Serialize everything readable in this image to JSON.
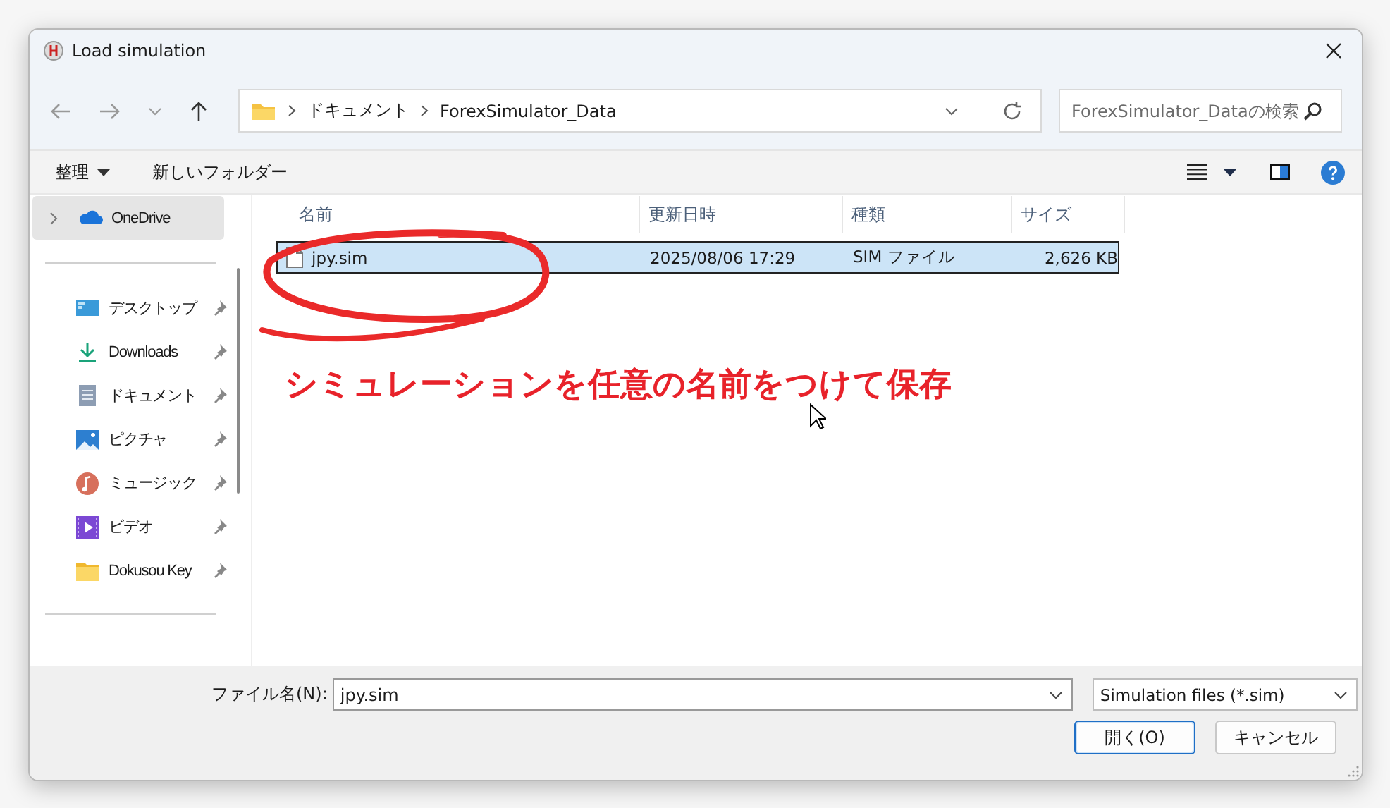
{
  "window": {
    "title": "Load simulation"
  },
  "nav": {
    "path": [
      "ドキュメント",
      "ForexSimulator_Data"
    ],
    "search": {
      "placeholder": "ForexSimulator_Dataの検索"
    }
  },
  "toolbar": {
    "items": [
      "整理",
      "新しいフォルダー"
    ]
  },
  "sidebar": {
    "items": [
      {
        "label": "OneDrive",
        "kind": "cloud",
        "selected": true,
        "pinned": false
      },
      {
        "label": "デスクトップ",
        "kind": "desktop",
        "selected": false,
        "pinned": true
      },
      {
        "label": "Downloads",
        "kind": "download",
        "selected": false,
        "pinned": true
      },
      {
        "label": "ドキュメント",
        "kind": "document",
        "selected": false,
        "pinned": true
      },
      {
        "label": "ピクチャ",
        "kind": "picture",
        "selected": false,
        "pinned": true
      },
      {
        "label": "ミュージック",
        "kind": "music",
        "selected": false,
        "pinned": true
      },
      {
        "label": "ビデオ",
        "kind": "video",
        "selected": false,
        "pinned": true
      },
      {
        "label": "Dokusou Key",
        "kind": "folder",
        "selected": false,
        "pinned": true
      }
    ]
  },
  "table": {
    "columns": [
      "名前",
      "更新日時",
      "種類",
      "サイズ"
    ],
    "rows": [
      {
        "cells": [
          "jpy.sim",
          "2025/08/06 17:29",
          "SIM ファイル",
          "2,626 KB"
        ],
        "selected": true
      }
    ]
  },
  "annotation": {
    "text": "シミュレーションを任意の名前をつけて保存"
  },
  "footer": {
    "filename_label": "ファイル名(N):",
    "filename": "jpy.sim",
    "filter": "Simulation files (*.sim)",
    "buttons": [
      {
        "label": "開く(O)",
        "default": true
      },
      {
        "label": "キャンセル",
        "default": false
      }
    ]
  }
}
